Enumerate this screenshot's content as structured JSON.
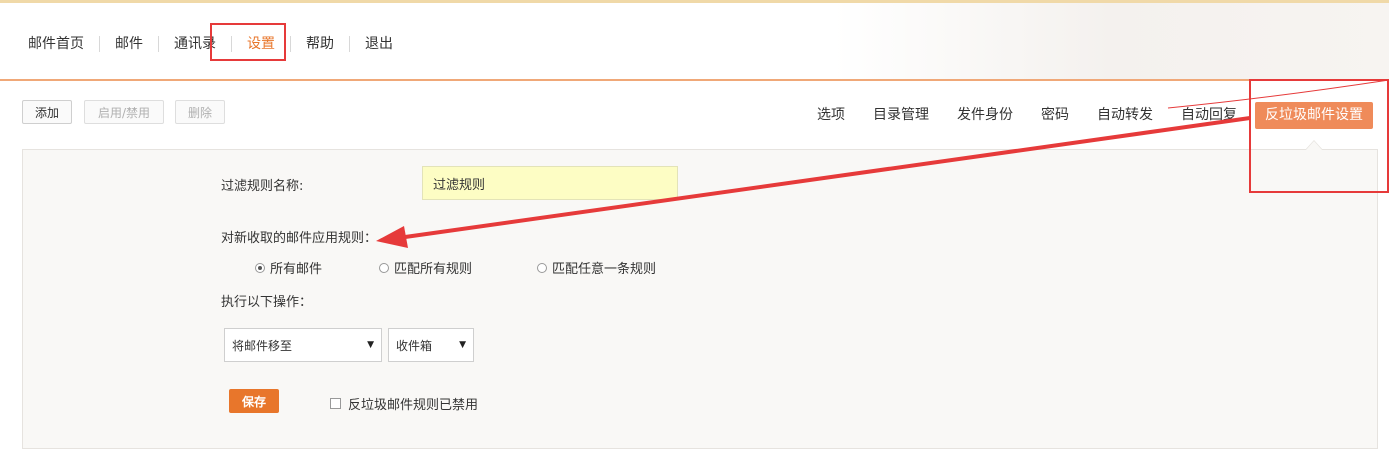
{
  "nav": {
    "items": [
      {
        "label": "邮件首页"
      },
      {
        "label": "邮件"
      },
      {
        "label": "通讯录"
      },
      {
        "label": "设置"
      },
      {
        "label": "帮助"
      },
      {
        "label": "退出"
      }
    ],
    "active_index": 3
  },
  "toolbar": {
    "add_label": "添加",
    "toggle_label": "启用/禁用",
    "delete_label": "删除"
  },
  "tabs": [
    {
      "label": "选项"
    },
    {
      "label": "目录管理"
    },
    {
      "label": "发件身份"
    },
    {
      "label": "密码"
    },
    {
      "label": "自动转发"
    },
    {
      "label": "自动回复"
    },
    {
      "label": "反垃圾邮件设置"
    }
  ],
  "form": {
    "rule_name_label": "过滤规则名称:",
    "rule_name_value": "过滤规则",
    "apply_label": "对新收取的邮件应用规则：",
    "radio_options": [
      {
        "label": "所有邮件",
        "checked": true
      },
      {
        "label": "匹配所有规则",
        "checked": false
      },
      {
        "label": "匹配任意一条规则",
        "checked": false
      }
    ],
    "action_label": "执行以下操作：",
    "action_select": "将邮件移至",
    "folder_select": "收件箱",
    "save_label": "保存",
    "disable_label": "反垃圾邮件规则已禁用"
  },
  "colors": {
    "accent": "#e8762b",
    "active_tab": "#ef8b5a",
    "annotation": "#e63a3a",
    "input_highlight": "#fdfdc4"
  }
}
